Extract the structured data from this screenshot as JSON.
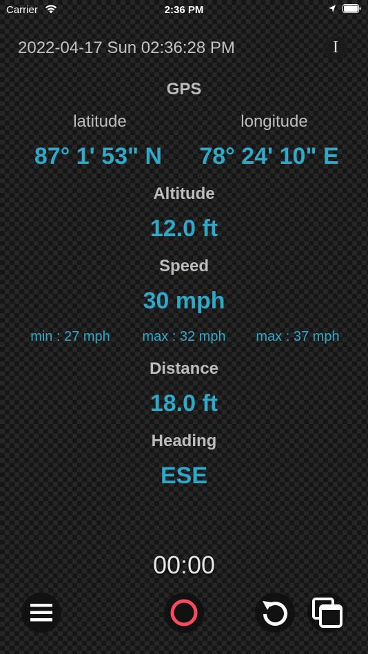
{
  "status_bar": {
    "carrier": "Carrier",
    "time": "2:36 PM"
  },
  "datetime": "2022-04-17 Sun 02:36:28 PM",
  "info_button": "I",
  "gps": {
    "title": "GPS",
    "latitude_label": "latitude",
    "longitude_label": "longitude",
    "latitude_value": "87° 1' 53\" N",
    "longitude_value": "78° 24' 10\" E"
  },
  "altitude": {
    "label": "Altitude",
    "value": "12.0 ft"
  },
  "speed": {
    "label": "Speed",
    "value": "30 mph",
    "min": "min : 27 mph",
    "avg": "max : 32 mph",
    "max": "max : 37 mph"
  },
  "distance": {
    "label": "Distance",
    "value": "18.0 ft"
  },
  "heading": {
    "label": "Heading",
    "value": "ESE"
  },
  "timer": "00:00",
  "toolbar": {
    "menu_icon": "hamburger-menu-icon",
    "record_icon": "record-circle-icon",
    "reset_icon": "reset-arrow-icon",
    "copy_icon": "stacked-windows-icon"
  },
  "colors": {
    "accent": "#30a8c8",
    "record": "#ff4a5e",
    "label": "#bdbdbd"
  }
}
